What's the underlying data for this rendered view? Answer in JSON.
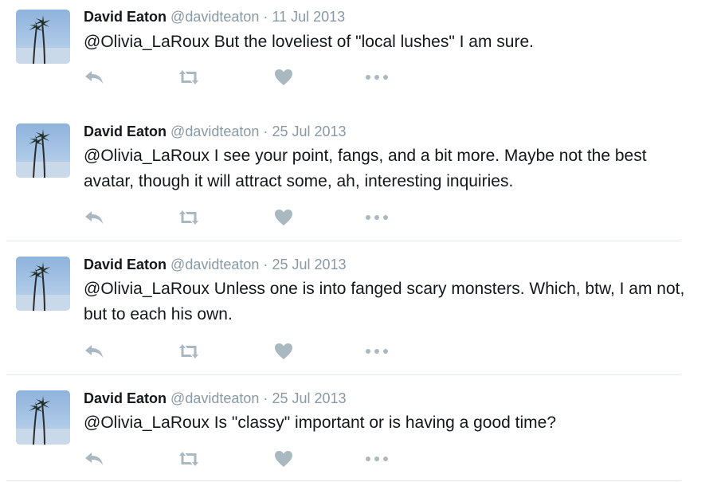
{
  "tweets": [
    {
      "author": "David Eaton",
      "handle": "@davidteaton",
      "dot": "·",
      "date": "11 Jul 2013",
      "text": "@Olivia_LaRoux But the loveliest of \"local lushes\" I am sure."
    },
    {
      "author": "David Eaton",
      "handle": "@davidteaton",
      "dot": "·",
      "date": "25 Jul 2013",
      "text": "@Olivia_LaRoux I see your point, fangs, and a bit more. Maybe not the best avatar, though it will attract some, ah, interesting inquiries."
    },
    {
      "author": "David Eaton",
      "handle": "@davidteaton",
      "dot": "·",
      "date": "25 Jul 2013",
      "text": "@Olivia_LaRoux Unless one is into fanged scary monsters. Which, btw, I am not, but to each his own."
    },
    {
      "author": "David Eaton",
      "handle": "@davidteaton",
      "dot": "·",
      "date": "25 Jul 2013",
      "text": "@Olivia_LaRoux Is \"classy\" important or is having a good time?"
    }
  ],
  "icons": {
    "avatar": "palm-trees-icon",
    "reply": "reply-icon",
    "retweet": "retweet-icon",
    "like": "heart-icon",
    "more": "more-icon"
  },
  "colors": {
    "text": "#14171a",
    "meta": "#8899a6",
    "icon": "#aab8c2",
    "divider": "#e1e8ed",
    "avatar_sky": "#a9c6e6"
  }
}
